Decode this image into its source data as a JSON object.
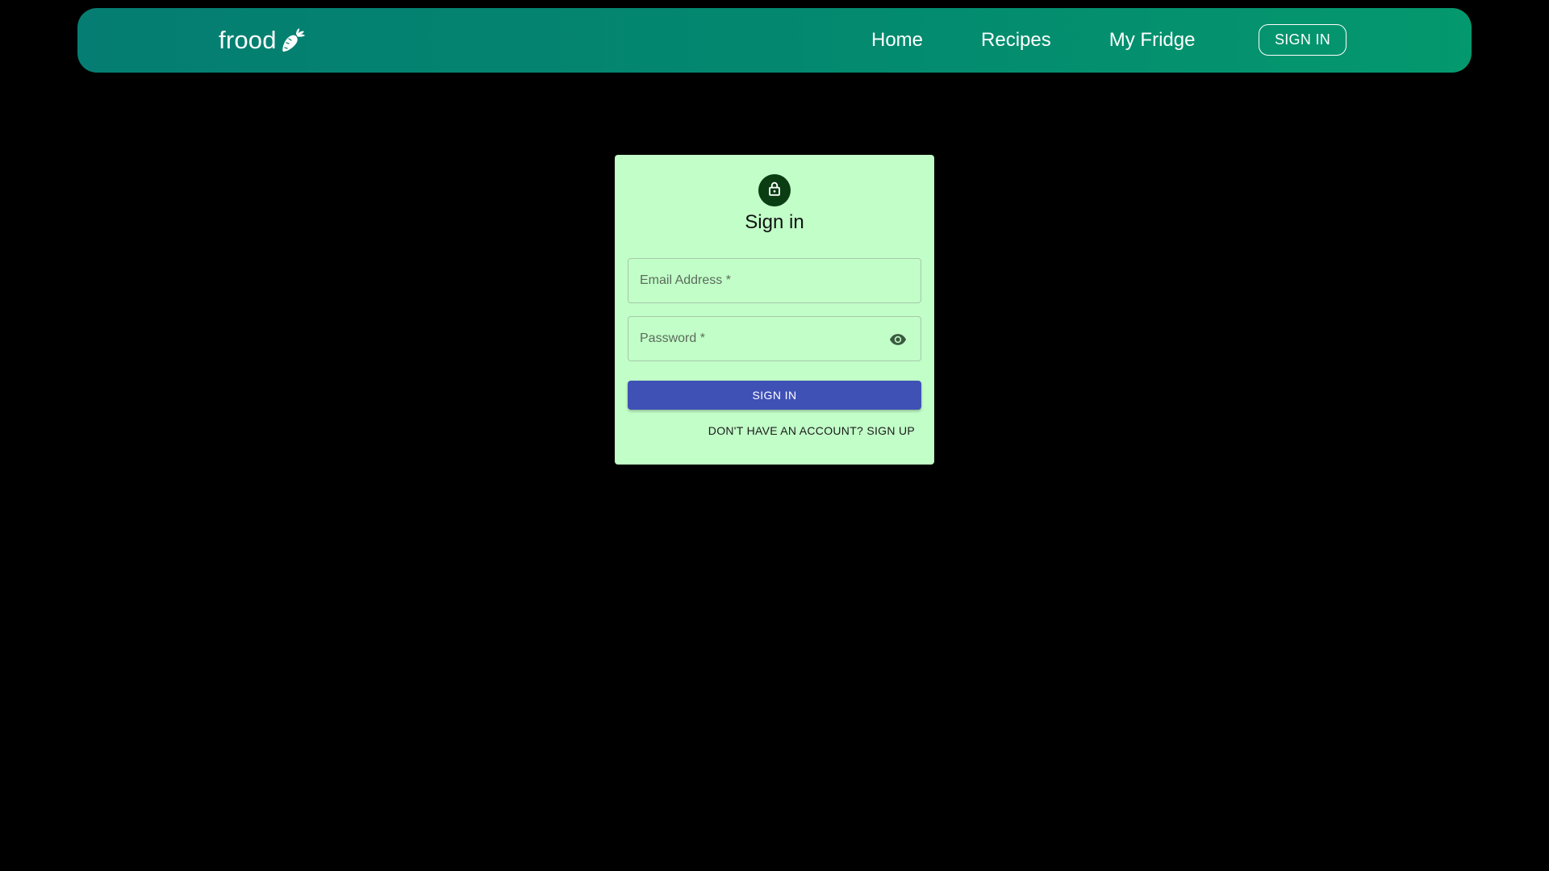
{
  "nav": {
    "brand": "frood",
    "brand_icon": "carrot-icon",
    "links": [
      "Home",
      "Recipes",
      "My Fridge"
    ],
    "signin_label": "SIGN IN",
    "gradient_start": "#057d72",
    "gradient_end": "#04986e"
  },
  "card": {
    "title": "Sign in",
    "lock_icon": "lock-icon",
    "email_placeholder": "Email Address *",
    "email_value": "",
    "password_placeholder": "Password *",
    "password_value": "",
    "eye_icon": "eye-icon",
    "submit_label": "SIGN IN",
    "signup_label": "DON'T HAVE AN ACCOUNT? SIGN UP",
    "background": "#c2fec8",
    "button_color": "#3f51b5",
    "avatar_color": "#0a3e12"
  }
}
